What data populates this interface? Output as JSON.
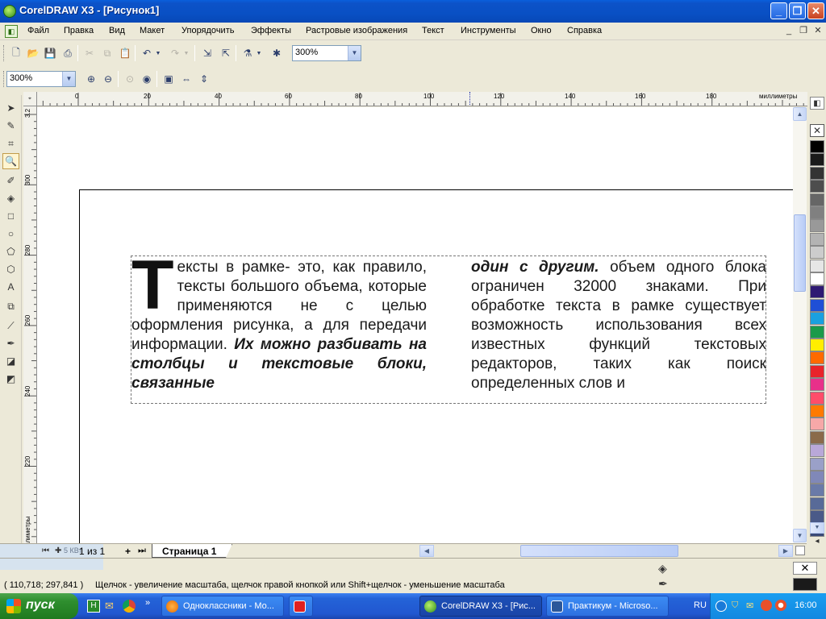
{
  "window": {
    "title": "CorelDRAW X3 - [Рисунок1]",
    "minimize": "_",
    "maximize": "❐",
    "close": "✕"
  },
  "menu": {
    "items": [
      "Файл",
      "Правка",
      "Вид",
      "Макет",
      "Упорядочить",
      "Эффекты",
      "Растровые изображения",
      "Текст",
      "Инструменты",
      "Окно",
      "Справка"
    ],
    "doc_minimize": "_",
    "doc_restore": "❐",
    "doc_close": "✕"
  },
  "toolbar": {
    "zoom_combo": "300%",
    "zoom_combo2": "300%"
  },
  "rulers": {
    "unit": "миллиметры",
    "h_ticks": [
      "0",
      "20",
      "40",
      "60",
      "80",
      "100",
      "120",
      "140",
      "160",
      "180"
    ],
    "v_ticks": [
      "300",
      "280",
      "260",
      "240",
      "220"
    ],
    "corner": "3.2",
    "vunit": "миллиметры"
  },
  "text_frame": {
    "col1_drop": "Т",
    "col1_a": "ексты в рамке- это, как правило, тексты большого объема, которые применяются не с целью оформления рисунка, а для передачи информации.",
    "col1_b": "Их можно разбивать на столбцы и текстовые блоки, связанные",
    "col2_a": "один с другим.",
    "col2_b": "объем одного блока ограничен 32000 знаками. При обработке текста в рамке существует возможность использования всех известных функций текстовых редакторов, таких как поиск определенных слов и"
  },
  "page_tabs": {
    "counter": "1 из 1",
    "tab": "Страница 1",
    "dim_label": "5 КВт"
  },
  "status": {
    "coords": "( 110,718; 297,841 )",
    "hint": "Щелчок - увеличение масштаба, щелчок правой кнопкой или Shift+щелчок - уменьшение масштаба"
  },
  "taskbar": {
    "start": "пуск",
    "tasks": [
      "Одноклассники - Мо...",
      "CorelDRAW X3 - [Рис...",
      "Практикум - Microso..."
    ],
    "lang": "RU",
    "time": "16:00"
  },
  "palette": [
    "#000000",
    "#1a1a1a",
    "#333333",
    "#4d4d4d",
    "#666666",
    "#808080",
    "#999999",
    "#b3b3b3",
    "#cccccc",
    "#e6e6e6",
    "#ffffff",
    "#2e1a73",
    "#1f4fd6",
    "#1aa0e0",
    "#1a9a4a",
    "#ffee00",
    "#ff6a00",
    "#e8232a",
    "#e8308a",
    "#ff4d6a",
    "#ff7a00",
    "#f7a8a8",
    "#8a6a4a",
    "#b9a8d9",
    "#9aa0c8",
    "#8088b8",
    "#6a7aa8",
    "#586a98",
    "#4a5a88",
    "#3a4a78"
  ],
  "colors": {
    "title_bar": "#0a5fdc",
    "taskbar": "#2463d8",
    "start_button": "#2f8f2f"
  }
}
